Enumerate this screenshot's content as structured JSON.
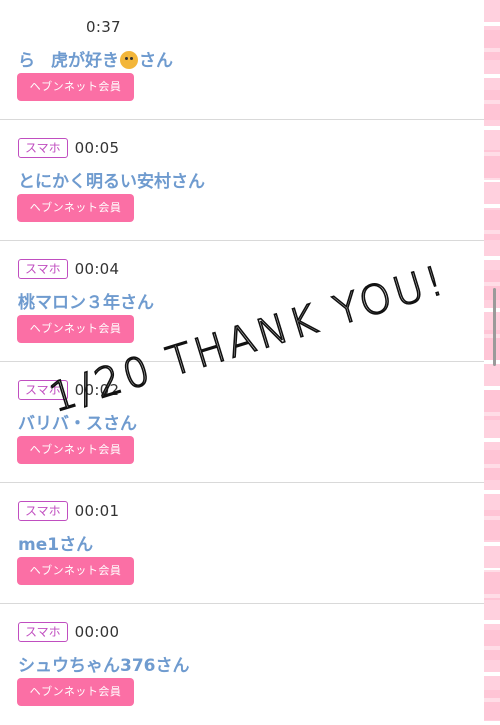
{
  "entries": [
    {
      "badge": "",
      "time": "0:37",
      "name_prefix": "ら",
      "name_mid": "虎が好き",
      "name_suffix": "さん",
      "tiger_icon": "tiger-face-emoji",
      "member": "ヘブンネット会員"
    },
    {
      "badge": "スマホ",
      "time": "00:05",
      "name": "とにかく明るい安村さん",
      "member": "ヘブンネット会員"
    },
    {
      "badge": "スマホ",
      "time": "00:04",
      "name": "桃マロン３年さん",
      "member": "ヘブンネット会員"
    },
    {
      "badge": "スマホ",
      "time": "00:02",
      "name": "バリバ・スさん",
      "member": "ヘブンネット会員"
    },
    {
      "badge": "スマホ",
      "time": "00:01",
      "name": "me1さん",
      "member": "ヘブンネット会員"
    },
    {
      "badge": "スマホ",
      "time": "00:00",
      "name": "シュウちゃん376さん",
      "member": "ヘブンネット会員"
    }
  ],
  "overlay_text": "1/20 THANK YOU!",
  "colors": {
    "badge": "#c04ec0",
    "name": "#6f9bcf",
    "member_button": "#fb6fa5",
    "rail": "#ffd0de"
  }
}
